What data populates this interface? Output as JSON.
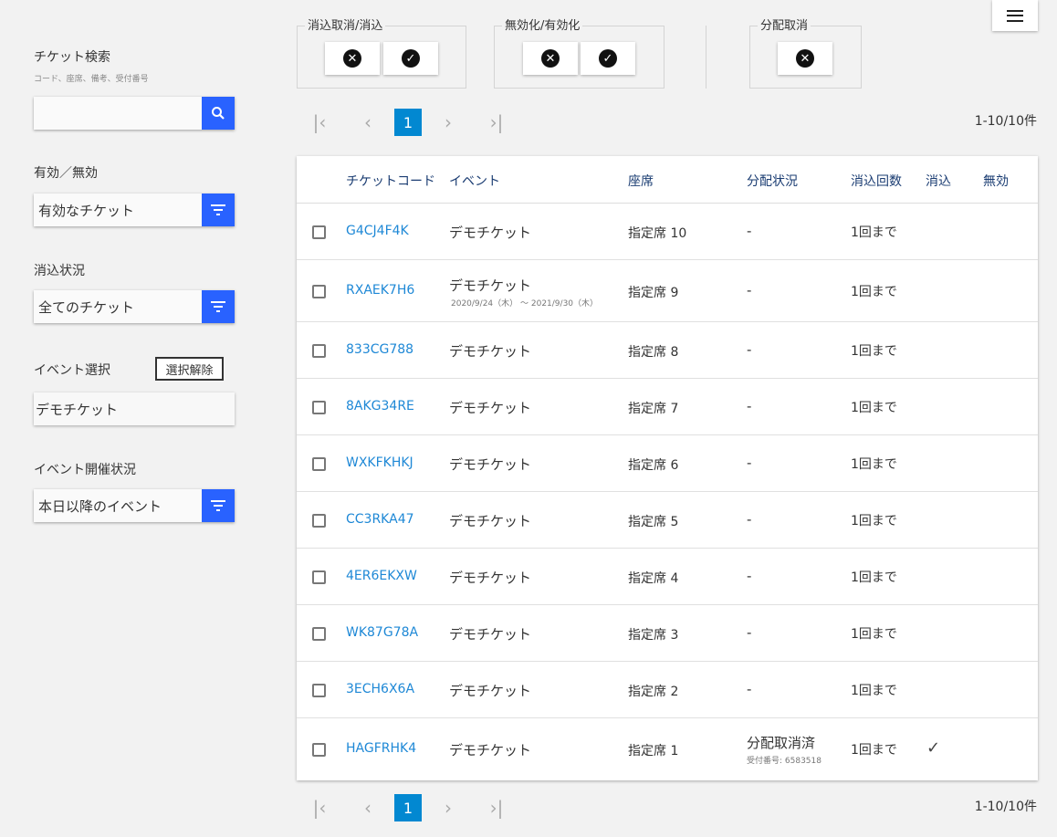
{
  "sidebar": {
    "search_label": "チケット検索",
    "search_hint": "コード、座席、備考、受付番号",
    "search_value": "",
    "validity_label": "有効／無効",
    "validity_value": "有効なチケット",
    "consume_label": "消込状況",
    "consume_value": "全てのチケット",
    "event_label": "イベント選択",
    "event_clear": "選択解除",
    "event_value": "デモチケット",
    "held_label": "イベント開催状況",
    "held_value": "本日以降のイベント"
  },
  "actions": {
    "consume_group": "消込取消/消込",
    "enable_group": "無効化/有効化",
    "distribute_group": "分配取消"
  },
  "pagination": {
    "current": "1",
    "count_text": "1-10/10件"
  },
  "table": {
    "headers": {
      "code": "チケットコード",
      "event": "イベント",
      "seat": "座席",
      "distribution": "分配状況",
      "consume_count": "消込回数",
      "consumed": "消込",
      "disabled": "無効"
    },
    "rows": [
      {
        "code": "G4CJ4F4K",
        "event": "デモチケット",
        "seat": "指定席 10",
        "dist": "-",
        "count": "1回まで"
      },
      {
        "code": "RXAEK7H6",
        "event": "デモチケット",
        "event_sub": "2020/9/24（木） ～ 2021/9/30（木）",
        "seat": "指定席 9",
        "dist": "-",
        "count": "1回まで"
      },
      {
        "code": "833CG788",
        "event": "デモチケット",
        "seat": "指定席 8",
        "dist": "-",
        "count": "1回まで"
      },
      {
        "code": "8AKG34RE",
        "event": "デモチケット",
        "seat": "指定席 7",
        "dist": "-",
        "count": "1回まで"
      },
      {
        "code": "WXKFKHKJ",
        "event": "デモチケット",
        "seat": "指定席 6",
        "dist": "-",
        "count": "1回まで"
      },
      {
        "code": "CC3RKA47",
        "event": "デモチケット",
        "seat": "指定席 5",
        "dist": "-",
        "count": "1回まで"
      },
      {
        "code": "4ER6EKXW",
        "event": "デモチケット",
        "seat": "指定席 4",
        "dist": "-",
        "count": "1回まで"
      },
      {
        "code": "WK87G78A",
        "event": "デモチケット",
        "seat": "指定席 3",
        "dist": "-",
        "count": "1回まで"
      },
      {
        "code": "3ECH6X6A",
        "event": "デモチケット",
        "seat": "指定席 2",
        "dist": "-",
        "count": "1回まで"
      },
      {
        "code": "HAGFRHK4",
        "event": "デモチケット",
        "seat": "指定席 1",
        "dist": "分配取消済",
        "dist_sub": "受付番号: 6583518",
        "count": "1回まで",
        "consumed": "✓"
      }
    ]
  }
}
